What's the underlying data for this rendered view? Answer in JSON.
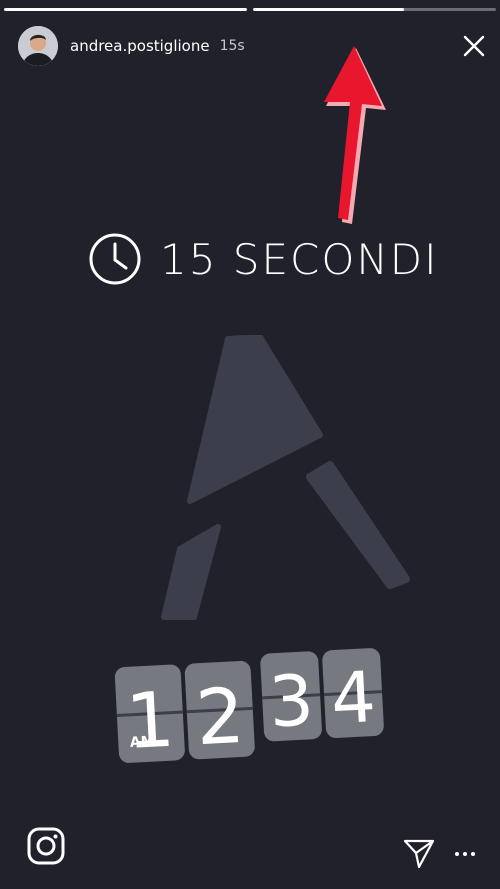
{
  "story": {
    "progress": [
      1,
      0.62,
      0
    ],
    "username": "andrea.postiglione",
    "time": "15s"
  },
  "content": {
    "headline": "15 SECONDI",
    "clock": {
      "hour_1": "1",
      "hour_2": "2",
      "minute_1": "3",
      "minute_2": "4",
      "meridiem": "AM"
    }
  },
  "icons": {
    "close": "close-icon",
    "arrow": "red-arrow-up",
    "clock": "clock-icon",
    "logo": "brand-logo",
    "instagram": "instagram-icon",
    "send": "send-icon",
    "more": "more-dots-icon"
  },
  "colors": {
    "background": "#20212b",
    "arrow": "#e8172d",
    "logo": "#3c3e4b",
    "flap": "#777980"
  }
}
